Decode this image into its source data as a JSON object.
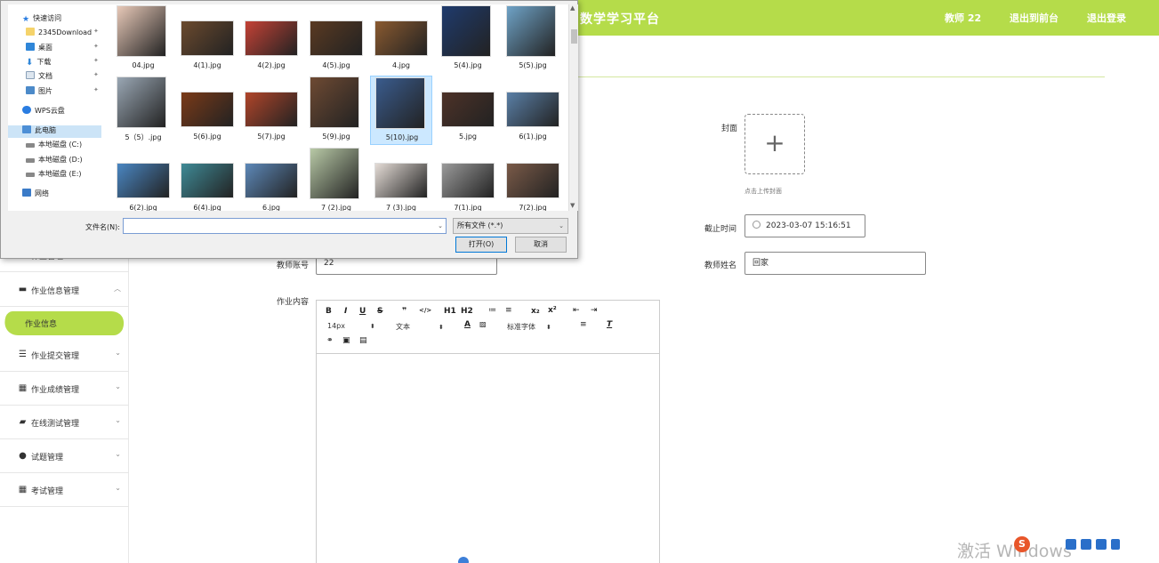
{
  "header": {
    "title": "数学学习平台",
    "nav": [
      "教师 22",
      "退出到前台",
      "退出登录"
    ]
  },
  "sidebar": {
    "partial_item": "作业管理",
    "items": [
      {
        "label": "作业信息管理",
        "icon": "chat-icon",
        "expanded": true
      },
      {
        "label": "作业提交管理",
        "icon": "sliders-icon"
      },
      {
        "label": "作业成绩管理",
        "icon": "grid-icon"
      },
      {
        "label": "在线测试管理",
        "icon": "ticket-icon"
      },
      {
        "label": "试题管理",
        "icon": "pin-icon"
      },
      {
        "label": "考试管理",
        "icon": "grid-icon"
      }
    ],
    "active_sub": "作业信息"
  },
  "form": {
    "cover_label": "封面",
    "cover_hint": "点击上传封面",
    "deadline_label": "截止时间",
    "deadline_value": "2023-03-07 15:16:51",
    "teacher_account_label": "教师账号",
    "teacher_account_value": "22",
    "teacher_name_label": "教师姓名",
    "teacher_name_value": "回家",
    "content_label": "作业内容"
  },
  "editor": {
    "buttons": [
      "B",
      "I",
      "U",
      "S",
      "❞",
      "</>",
      "H1",
      "H2",
      "≔",
      "≡",
      "x₂",
      "x²",
      "⇤",
      "⇥"
    ],
    "font_size": "14px",
    "block_type": "文本",
    "font_family": "标准字体"
  },
  "dialog": {
    "nav": {
      "quick_access": "快速访问",
      "items": [
        "2345Download",
        "桌面",
        "下载",
        "文档",
        "图片"
      ],
      "wps": "WPS云盘",
      "this_pc": "此电脑",
      "drives": [
        "本地磁盘 (C:)",
        "本地磁盘 (D:)",
        "本地磁盘 (E:)"
      ],
      "network": "网络"
    },
    "files": [
      {
        "name": "04.jpg",
        "color": "#e8c9b8"
      },
      {
        "name": "4(1).jpg",
        "color": "#6b4a2e"
      },
      {
        "name": "4(2).jpg",
        "color": "#c44236"
      },
      {
        "name": "4(5).jpg",
        "color": "#5a3a22"
      },
      {
        "name": "4.jpg",
        "color": "#8a5a30"
      },
      {
        "name": "5(4).jpg",
        "color": "#1f3b6d"
      },
      {
        "name": "5(5).jpg",
        "color": "#6fa3c7"
      },
      {
        "name": "5（5）.jpg",
        "color": "#9aa7b4"
      },
      {
        "name": "5(6).jpg",
        "color": "#7a3a18"
      },
      {
        "name": "5(7).jpg",
        "color": "#b0452a"
      },
      {
        "name": "5(9).jpg",
        "color": "#6e4a33"
      },
      {
        "name": "5(10).jpg",
        "color": "#3a5c8e"
      },
      {
        "name": "5.jpg",
        "color": "#4d3228"
      },
      {
        "name": "6(1).jpg",
        "color": "#5a7fa6"
      },
      {
        "name": "6(2).jpg",
        "color": "#4a86c2"
      },
      {
        "name": "6(4).jpg",
        "color": "#3f8a96"
      },
      {
        "name": "6.jpg",
        "color": "#5d88b8"
      },
      {
        "name": "7 (2).jpg",
        "color": "#b8c9a6"
      },
      {
        "name": "7 (3).jpg",
        "color": "#e4dcd6"
      },
      {
        "name": "7(1).jpg",
        "color": "#9a9a9a"
      },
      {
        "name": "7(2).jpg",
        "color": "#7a5a48"
      }
    ],
    "selected_file": "5(10).jpg",
    "filename_label": "文件名(N):",
    "filename_value": "",
    "filetype": "所有文件 (*.*)",
    "open_button": "打开(O)",
    "cancel_button": "取消"
  },
  "watermark": "激活 Windows"
}
